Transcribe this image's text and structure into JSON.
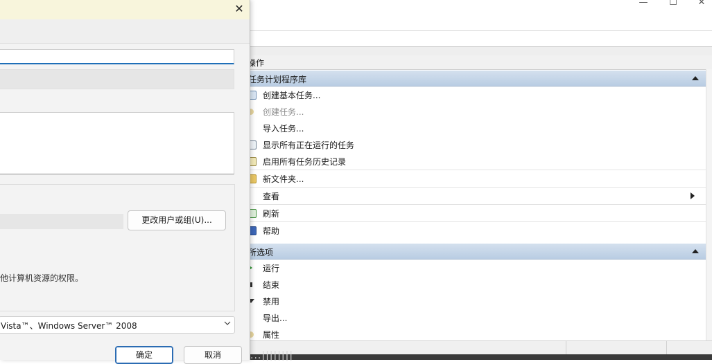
{
  "app": {
    "window_controls": {
      "minimize": "—",
      "maximize": "☐",
      "close": "✕"
    },
    "actions_pane": {
      "header": "操作",
      "sections": [
        {
          "title": "任务计划程序库",
          "items": [
            {
              "label": "创建基本任务...",
              "icon": "create-basic-task-icon",
              "disabled": false
            },
            {
              "label": "创建任务...",
              "icon": "create-task-icon",
              "disabled": true
            },
            {
              "label": "导入任务...",
              "icon": "none",
              "disabled": false
            },
            {
              "label": "显示所有正在运行的任务",
              "icon": "running-tasks-icon",
              "disabled": false
            },
            {
              "label": "启用所有任务历史记录",
              "icon": "history-icon",
              "disabled": false
            },
            {
              "label": "新文件夹...",
              "icon": "folder-icon",
              "disabled": false
            },
            {
              "label": "查看",
              "icon": "none",
              "disabled": false,
              "submenu": true
            },
            {
              "label": "刷新",
              "icon": "refresh-icon",
              "disabled": false
            },
            {
              "label": "帮助",
              "icon": "help-icon",
              "disabled": false
            }
          ]
        },
        {
          "title": "所选项",
          "items": [
            {
              "label": "运行",
              "icon": "run-icon"
            },
            {
              "label": "结束",
              "icon": "end-icon"
            },
            {
              "label": "禁用",
              "icon": "disable-icon"
            },
            {
              "label": "导出...",
              "icon": "none"
            },
            {
              "label": "属性",
              "icon": "properties-icon"
            }
          ]
        }
      ]
    },
    "bottom_strip_text": "...||||||||"
  },
  "dialog": {
    "close_glyph": "✕",
    "change_user_button": "更改用户或组(U)...",
    "security_text": "他计算机资源的权限。",
    "configure_for": "Vista™、Windows Server™ 2008",
    "ok_button": "确定",
    "cancel_button": "取消"
  },
  "colors": {
    "section_header": "#c6d6e8",
    "accent_blue": "#1f6fb8",
    "dialog_titlebar": "#f8f5dc"
  }
}
